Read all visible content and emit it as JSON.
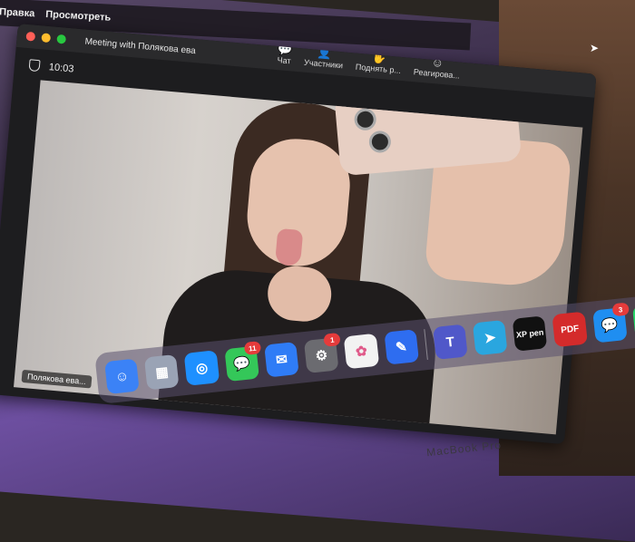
{
  "menubar": {
    "items": [
      "Правка",
      "Просмотреть"
    ]
  },
  "window": {
    "title": "Meeting with Полякова ева",
    "timer": "10:03",
    "toolbar": [
      {
        "label": "Чат",
        "icon": "chat-icon"
      },
      {
        "label": "Участники",
        "icon": "participants-icon"
      },
      {
        "label": "Поднять р...",
        "icon": "raise-hand-icon"
      },
      {
        "label": "Реагирова...",
        "icon": "reactions-icon"
      }
    ]
  },
  "video": {
    "participant_name": "Полякова ева..."
  },
  "dock": {
    "apps": [
      {
        "name": "Finder",
        "icon": "finder-icon",
        "color": "#3b82f6"
      },
      {
        "name": "Launchpad",
        "icon": "launchpad-icon",
        "color": "#9aa3b5"
      },
      {
        "name": "Safari",
        "icon": "safari-icon",
        "color": "#1e90ff"
      },
      {
        "name": "Messages",
        "icon": "messages-icon",
        "color": "#34c759",
        "badge": "11"
      },
      {
        "name": "Mail",
        "icon": "mail-icon",
        "color": "#2f7cf6"
      },
      {
        "name": "System Settings",
        "icon": "settings-icon",
        "color": "#6b6b70",
        "badge": "1"
      },
      {
        "name": "Photos",
        "icon": "photos-icon",
        "color": "#f2f2f2"
      },
      {
        "name": "Freeform",
        "icon": "pen-app-icon",
        "color": "#2e6df0"
      },
      {
        "name": "Teams",
        "icon": "teams-icon",
        "color": "#5058c9"
      },
      {
        "name": "Telegram",
        "icon": "telegram-icon",
        "color": "#2aa6df"
      },
      {
        "name": "XP-Pen",
        "icon": "xppen-icon",
        "color": "#111111",
        "text": "XP pen"
      },
      {
        "name": "PDF",
        "icon": "pdf-icon",
        "color": "#d42b2b",
        "text": "PDF"
      },
      {
        "name": "Chat",
        "icon": "chat-bubble-app-icon",
        "color": "#1f8ef1",
        "badge": "3"
      },
      {
        "name": "WhatsApp",
        "icon": "whatsapp-icon",
        "color": "#25d366"
      }
    ]
  },
  "device_label": "MacBook Pro"
}
